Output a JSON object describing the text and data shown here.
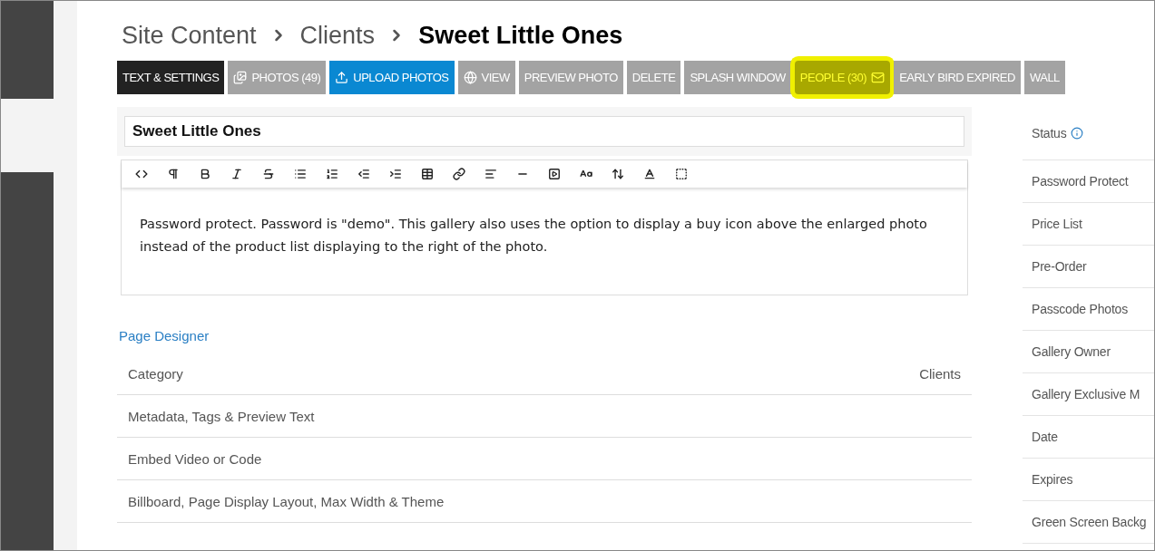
{
  "breadcrumb": {
    "items": [
      "Site Content",
      "Clients"
    ],
    "current": "Sweet Little Ones"
  },
  "tabs": [
    {
      "label": "TEXT & SETTINGS",
      "kind": "plain",
      "selected": true,
      "highlighted": false
    },
    {
      "label": "PHOTOS (49)",
      "kind": "photos",
      "selected": false,
      "highlighted": false
    },
    {
      "label": "UPLOAD PHOTOS",
      "kind": "upload",
      "selected": false,
      "highlighted": false
    },
    {
      "label": "VIEW",
      "kind": "view",
      "selected": false,
      "highlighted": false
    },
    {
      "label": "PREVIEW PHOTO",
      "kind": "plain",
      "selected": false,
      "highlighted": false
    },
    {
      "label": "DELETE",
      "kind": "plain",
      "selected": false,
      "highlighted": false
    },
    {
      "label": "SPLASH WINDOW",
      "kind": "plain",
      "selected": false,
      "highlighted": false
    },
    {
      "label": "PEOPLE (30)",
      "kind": "mail",
      "selected": false,
      "highlighted": true
    },
    {
      "label": "EARLY BIRD EXPIRED",
      "kind": "plain",
      "selected": false,
      "highlighted": false
    },
    {
      "label": "WALL",
      "kind": "plain",
      "selected": false,
      "highlighted": false
    }
  ],
  "title_field": {
    "value": "Sweet Little Ones"
  },
  "editor": {
    "text": "Password protect. Password is \"demo\". This gallery also uses the option to display a buy icon above the enlarged photo instead of the product list displaying to the right of the photo."
  },
  "page_designer_link": "Page Designer",
  "table": {
    "columns": [
      "Category",
      "Clients"
    ],
    "rows": [
      "Metadata, Tags & Preview Text",
      "Embed Video or Code",
      "Billboard, Page Display Layout, Max Width & Theme"
    ]
  },
  "settings": [
    {
      "label": "Status",
      "kind": "info"
    },
    {
      "label": "Password Protect",
      "kind": "plain"
    },
    {
      "label": "Price List",
      "kind": "plain"
    },
    {
      "label": "Pre-Order",
      "kind": "plain"
    },
    {
      "label": "Passcode Photos",
      "kind": "plain"
    },
    {
      "label": "Gallery Owner",
      "kind": "plain"
    },
    {
      "label": "Gallery Exclusive M",
      "kind": "plain"
    },
    {
      "label": "Date",
      "kind": "plain"
    },
    {
      "label": "Expires",
      "kind": "plain"
    },
    {
      "label": "Green Screen Backg",
      "kind": "plain"
    }
  ]
}
